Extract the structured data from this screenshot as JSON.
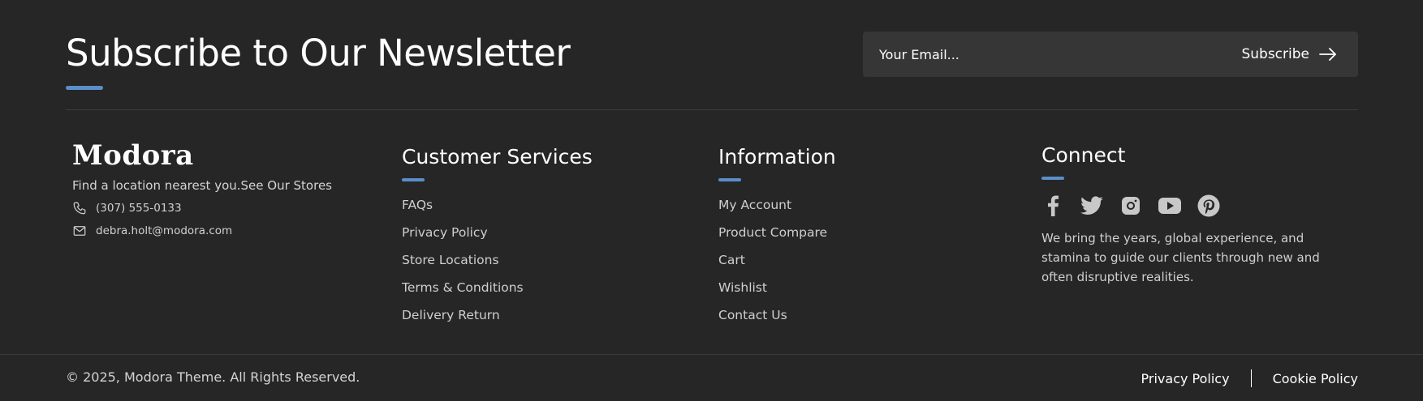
{
  "newsletter": {
    "title": "Subscribe to Our Newsletter",
    "email_placeholder": "Your Email...",
    "subscribe_label": "Subscribe"
  },
  "brand": {
    "logo_text": "Modora",
    "tagline": "Find a location nearest you.See Our Stores",
    "phone": "(307) 555-0133",
    "email": "debra.holt@modora.com"
  },
  "customer_services": {
    "title": "Customer Services",
    "links": [
      "FAQs",
      "Privacy Policy",
      "Store Locations",
      "Terms & Conditions",
      "Delivery Return"
    ]
  },
  "information": {
    "title": "Information",
    "links": [
      "My Account",
      "Product Compare",
      "Cart",
      "Wishlist",
      "Contact Us"
    ]
  },
  "connect": {
    "title": "Connect",
    "socials": [
      "facebook-icon",
      "twitter-icon",
      "instagram-icon",
      "youtube-icon",
      "pinterest-icon"
    ],
    "text": "We bring the years, global experience, and stamina to guide our clients through new and often disruptive realities."
  },
  "footer": {
    "copyright": "© 2025, Modora Theme. All Rights Reserved.",
    "privacy_label": "Privacy Policy",
    "cookie_label": "Cookie Policy"
  },
  "colors": {
    "background": "#262626",
    "accent": "#5b8ec9",
    "input_bg": "#363636"
  }
}
